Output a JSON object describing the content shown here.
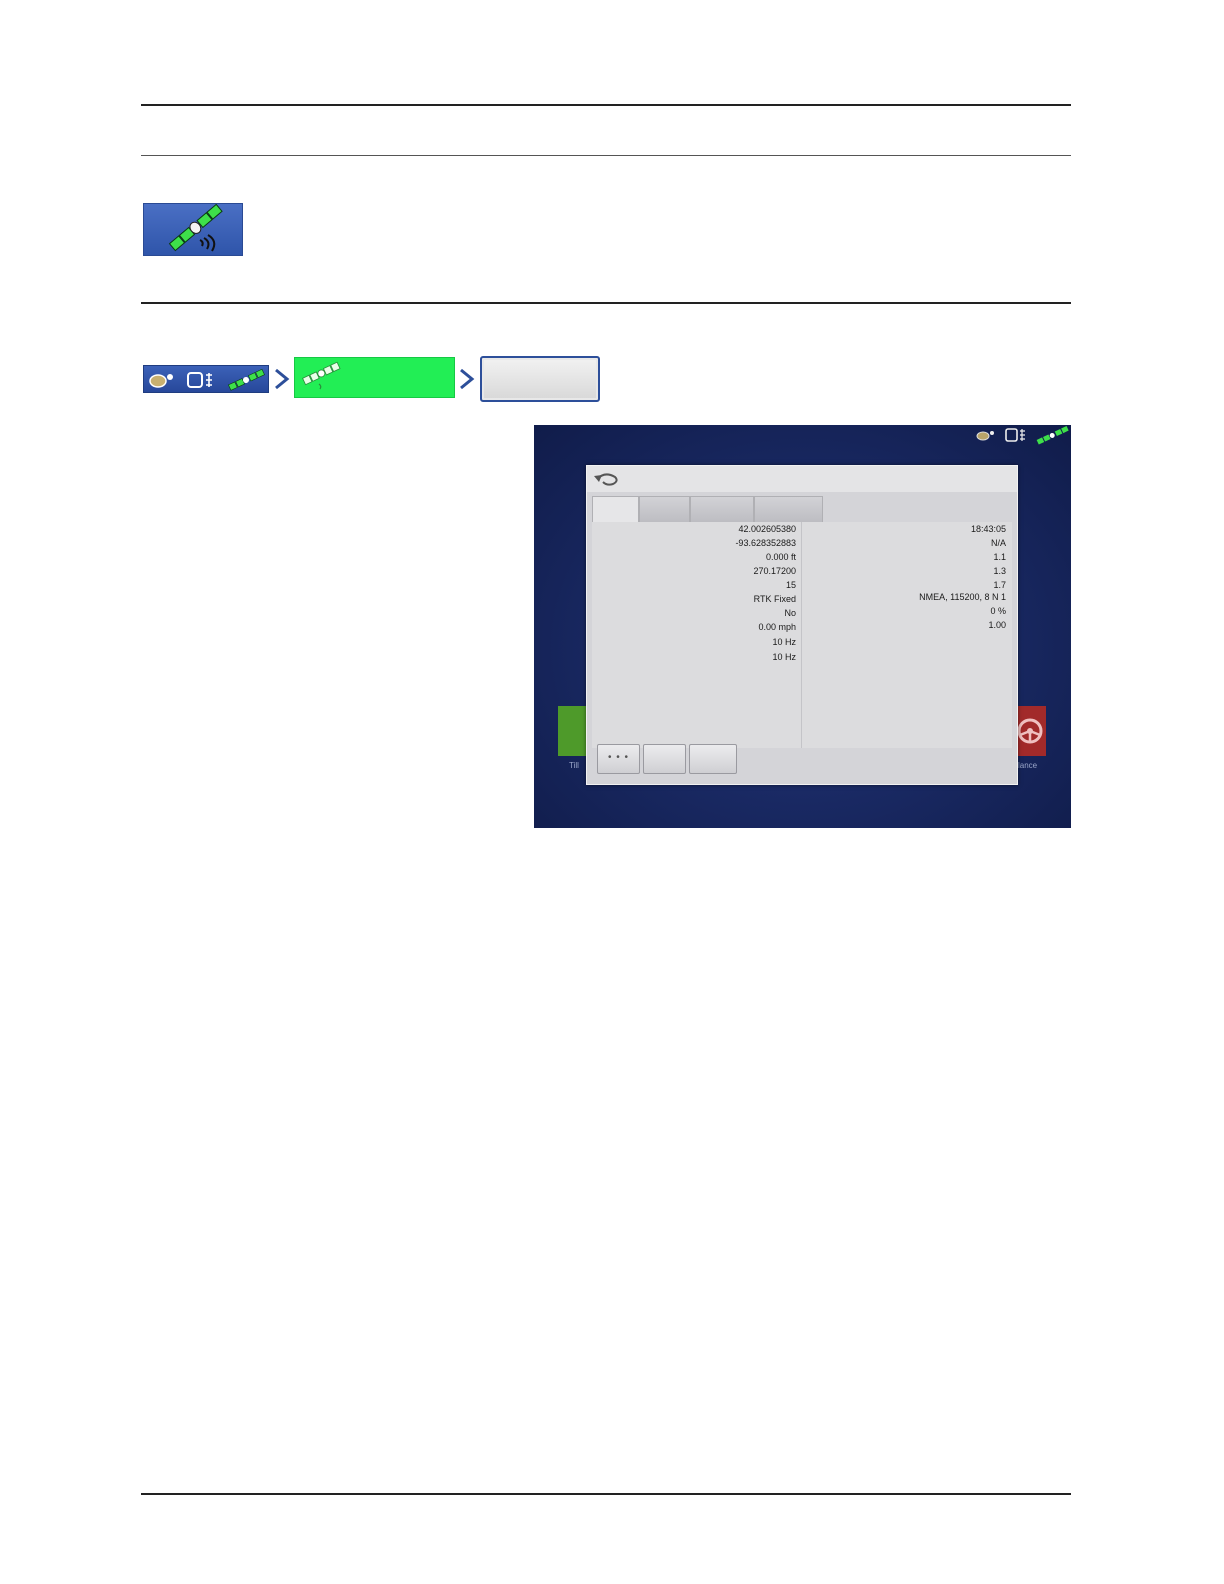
{
  "gps_info": {
    "left_values": [
      "42.002605380",
      "-93.628352883",
      "0.000 ft",
      "270.17200",
      "15",
      "RTK Fixed",
      "No",
      "0.00 mph",
      "10 Hz",
      "10 Hz"
    ],
    "right_values": [
      "18:43:05",
      "N/A",
      "1.1",
      "1.3",
      "1.7",
      "NMEA, 115200, 8 N 1",
      "0 %",
      "1.00"
    ],
    "more_button_label": "• • •"
  },
  "home_screen": {
    "left_tile_label": "Till",
    "right_tile_label": "lance"
  },
  "colors": {
    "nav_highlight": "#22ee55",
    "toolbar_blue": "#3c62b8",
    "device_background": "#1a2a65"
  }
}
